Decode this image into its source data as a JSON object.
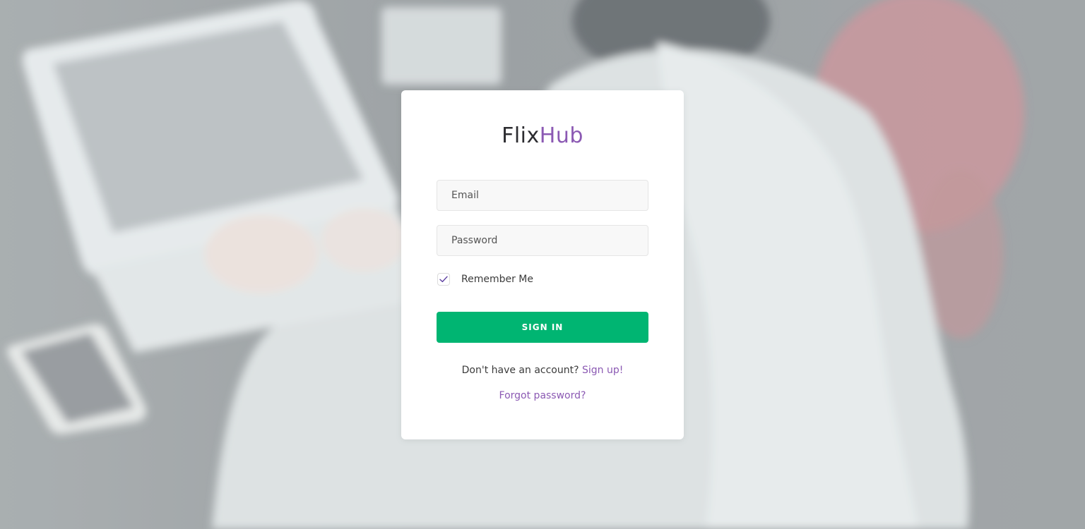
{
  "brand": {
    "part1": "Flix",
    "part2": "Hub",
    "color_dark": "#2c2c30",
    "color_accent": "#8b59b3"
  },
  "form": {
    "email_placeholder": "Email",
    "password_placeholder": "Password",
    "remember_label": "Remember Me",
    "remember_checked": true,
    "signin_label": "SIGN IN",
    "signin_color": "#00b572"
  },
  "footer": {
    "signup_prompt": "Don't have an account?",
    "signup_link": "Sign up!",
    "forgot_link": "Forgot password?"
  },
  "background": {
    "icon": "photo-person-laptop"
  }
}
